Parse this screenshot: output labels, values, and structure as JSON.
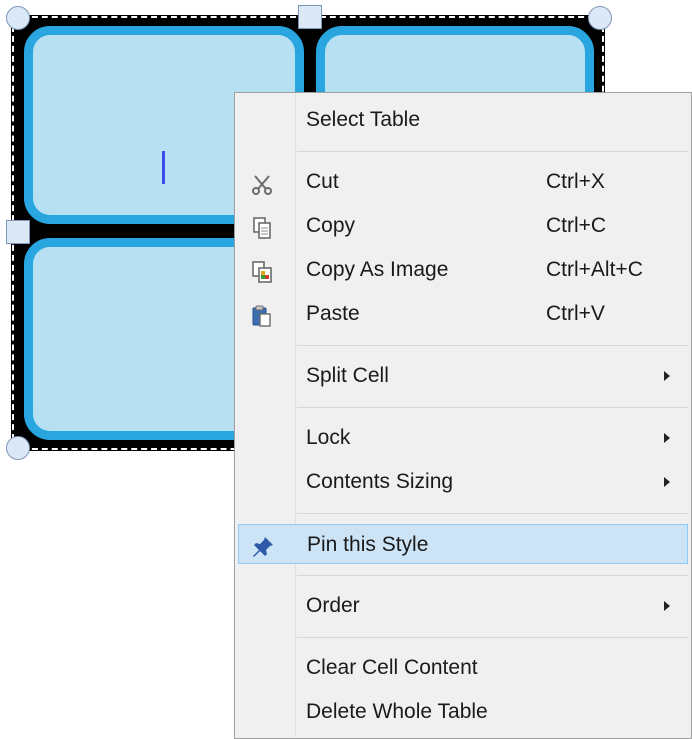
{
  "menu": {
    "select_table": "Select Table",
    "cut": {
      "label": "Cut",
      "shortcut": "Ctrl+X",
      "icon": "scissors-icon"
    },
    "copy": {
      "label": "Copy",
      "shortcut": "Ctrl+C",
      "icon": "copy-icon"
    },
    "copy_as_image": {
      "label": "Copy As Image",
      "shortcut": "Ctrl+Alt+C",
      "icon": "copy-as-image-icon"
    },
    "paste": {
      "label": "Paste",
      "shortcut": "Ctrl+V",
      "icon": "paste-icon"
    },
    "split_cell": "Split Cell",
    "lock": "Lock",
    "contents_sizing": "Contents Sizing",
    "pin_this_style": {
      "label": "Pin this Style",
      "icon": "pin-icon"
    },
    "order": "Order",
    "clear_cell_content": "Clear Cell Content",
    "delete_whole_table": "Delete Whole Table"
  },
  "colors": {
    "cell_fill": "#b7e1f3",
    "cell_border": "#29a6e0",
    "menu_background": "#f0f0f0",
    "highlight": "#cde4f7",
    "text_cursor": "#3b4bf0"
  }
}
